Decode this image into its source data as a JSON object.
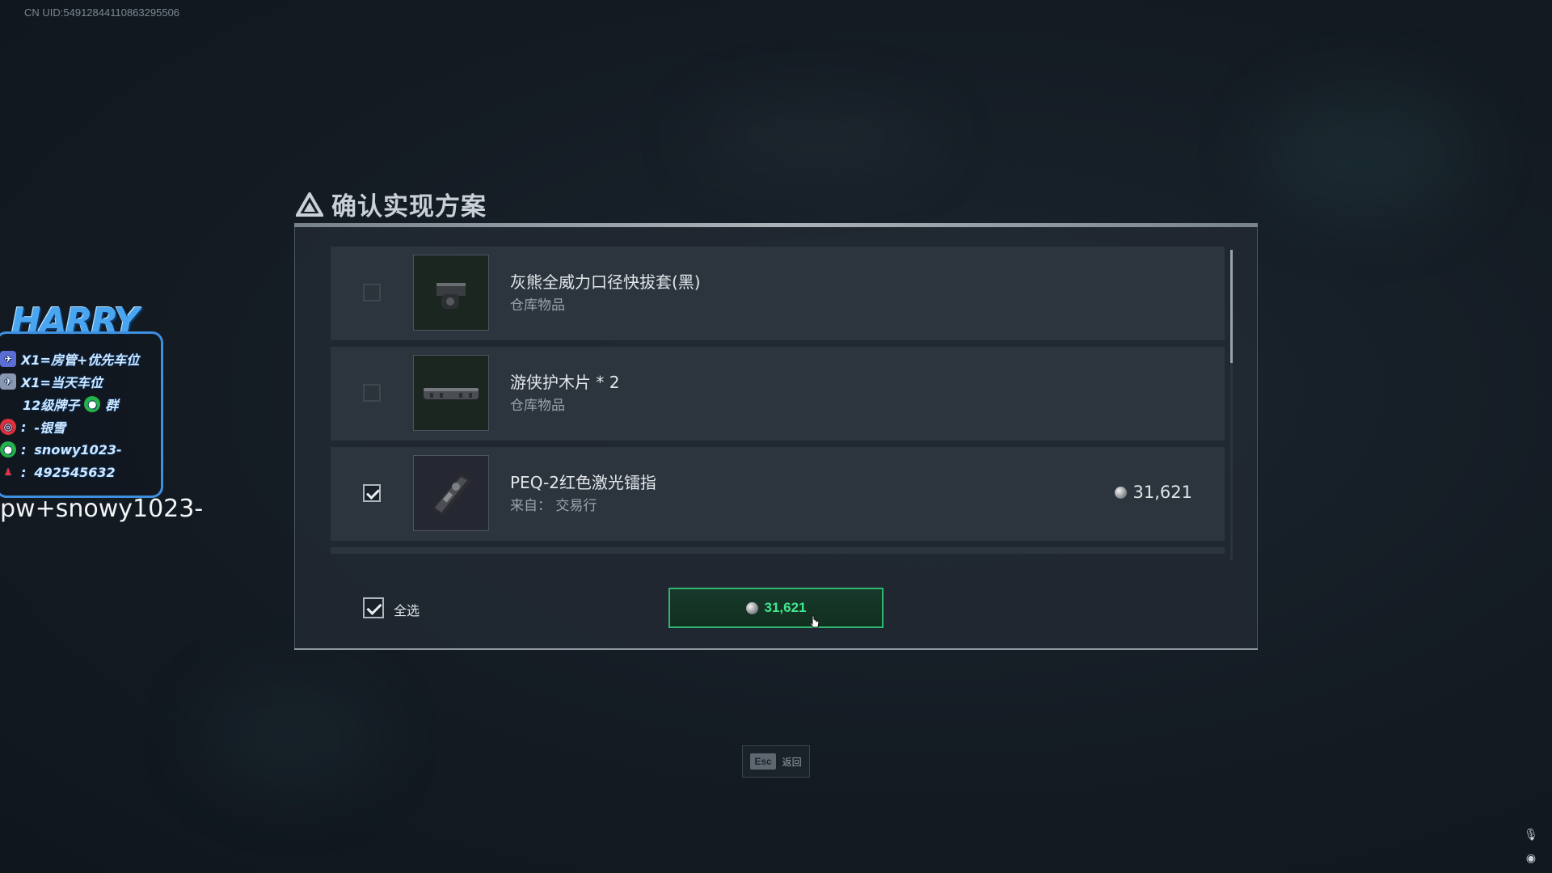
{
  "uid": "CN UID:54912844110863295506",
  "overlay": {
    "logo": "HARRY",
    "lines": [
      {
        "text": "X1=房管+优先车位",
        "icon": "rocket-icon"
      },
      {
        "text": "X1=当天车位",
        "icon": "plane-icon"
      },
      {
        "text": "12级牌子",
        "suffix": "群",
        "icon": "wechat-icon"
      },
      {
        "text": "-银雪",
        "icon": "weibo-icon"
      },
      {
        "text": "snowy1023-",
        "icon": "wechat-icon"
      },
      {
        "text": "492545632",
        "icon": "qq-icon"
      }
    ],
    "colon": ":",
    "handle": "pw+snowy1023-"
  },
  "dialog": {
    "title": "确认实现方案",
    "items": [
      {
        "name": "灰熊全威力口径快拔套(黑)",
        "sub": "仓库物品",
        "checked": false,
        "price": ""
      },
      {
        "name": "游侠护木片 * 2",
        "sub": "仓库物品",
        "checked": false,
        "price": ""
      },
      {
        "name": "PEQ-2红色激光镭指",
        "sub": "来自： 交易行",
        "checked": true,
        "price": "31,621"
      }
    ],
    "select_all": "全选",
    "total": "31,621"
  },
  "footer": {
    "esc_key": "Esc",
    "esc_label": "返回"
  }
}
